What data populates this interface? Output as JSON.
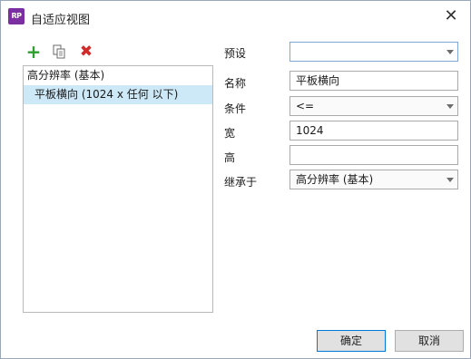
{
  "window": {
    "title": "自适应视图",
    "app_icon_text": "RP",
    "close_symbol": "✕"
  },
  "toolbar": {
    "add_icon": "plus-icon",
    "copy_icon": "copy-icon",
    "delete_icon": "delete-icon",
    "colors": {
      "add": "#2e9e2e",
      "delete": "#d02a2a"
    }
  },
  "views": [
    {
      "label": "高分辨率 (基本)",
      "selected": false
    },
    {
      "label": "平板横向 (1024 x 任何 以下)",
      "selected": true
    }
  ],
  "form": {
    "preset_label": "预设",
    "preset_value": "",
    "name_label": "名称",
    "name_value": "平板横向",
    "condition_label": "条件",
    "condition_value": "<=",
    "width_label": "宽",
    "width_value": "1024",
    "height_label": "高",
    "height_value": "",
    "inherit_label": "继承于",
    "inherit_value": "高分辨率 (基本)"
  },
  "buttons": {
    "ok": "确定",
    "cancel": "取消"
  }
}
